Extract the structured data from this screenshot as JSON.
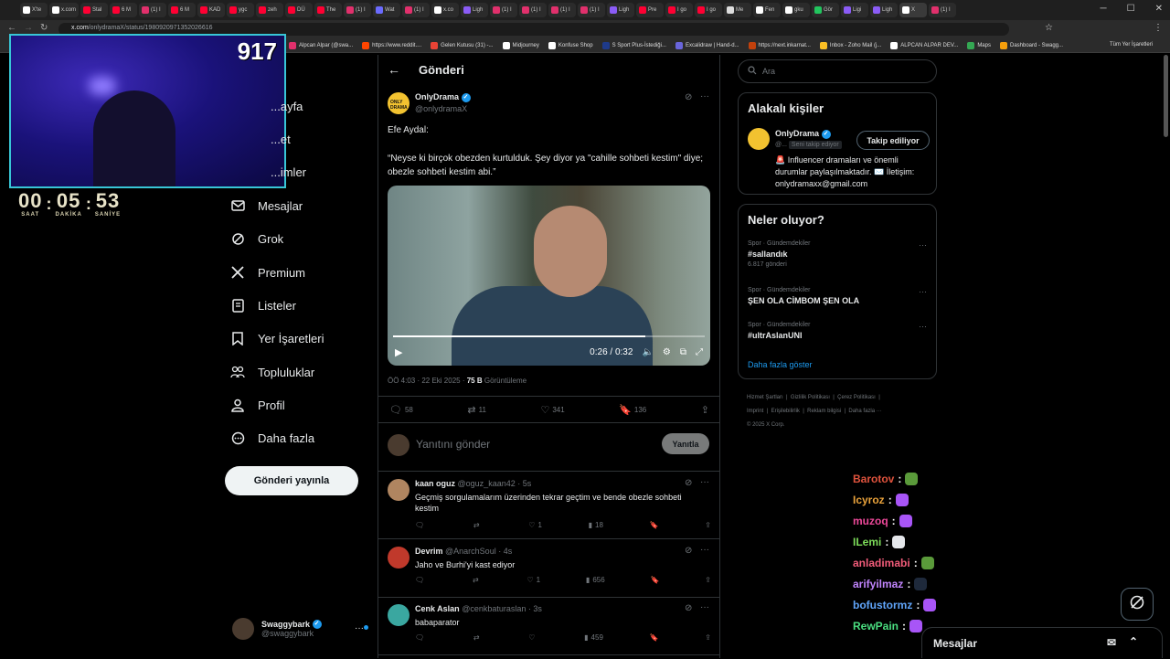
{
  "browser": {
    "tabs": [
      "X'te",
      "x.com",
      "Stal",
      "6 M",
      "(1) I",
      "6 M",
      "KAD",
      "ygc",
      "zeh",
      "DÜ",
      "The",
      "(1) I",
      "Wat",
      "(1) I",
      "x.co",
      "Ligh",
      "(1) I",
      "(1) I",
      "(1) I",
      "(1) I",
      "Ligh",
      "Pre",
      "I go",
      "I go",
      "Me",
      "Fen",
      "gku",
      "Gör",
      "Ligi",
      "Ligh",
      "X",
      "(1) I"
    ],
    "tab_colors": [
      "#fff",
      "#fff",
      "#ff0033",
      "#ff0033",
      "#e1306c",
      "#ff0033",
      "#ff0033",
      "#ff0033",
      "#ff0033",
      "#ff0033",
      "#ff0033",
      "#e1306c",
      "#6b6bff",
      "#e1306c",
      "#fff",
      "#8b5cf6",
      "#e1306c",
      "#e1306c",
      "#e1306c",
      "#e1306c",
      "#8b5cf6",
      "#ff0033",
      "#ff0033",
      "#ff0033",
      "#ddd",
      "#fff",
      "#fff",
      "#22c55e",
      "#8b5cf6",
      "#8b5cf6",
      "#fff",
      "#e1306c"
    ],
    "url_host": "x.com",
    "url_path": "/onlydramaX/status/1980920971352026616",
    "bookmarks": [
      {
        "label": "Alpcan Alpar (@swa...",
        "color": "#e1306c"
      },
      {
        "label": "https://www.reddit....",
        "color": "#ff4500"
      },
      {
        "label": "Gelen Kutusu (31) -...",
        "color": "#ea4335"
      },
      {
        "label": "Midjourney",
        "color": "#ffffff"
      },
      {
        "label": "Konfuse Shop",
        "color": "#ffffff"
      },
      {
        "label": "S Sport Plus-İstediği...",
        "color": "#1e3a8a"
      },
      {
        "label": "Excalidraw | Hand-d...",
        "color": "#6965db"
      },
      {
        "label": "https://next.inkarnat...",
        "color": "#c2410c"
      },
      {
        "label": "Inbox - Zoho Mail (j...",
        "color": "#fbbf24"
      },
      {
        "label": "ALPCAN ALPAR DEV...",
        "color": "#ffffff"
      },
      {
        "label": "Maps",
        "color": "#34a853"
      },
      {
        "label": "Dashboard - Swagg...",
        "color": "#f59e0b"
      }
    ],
    "all_bookmarks": "Tüm Yer İşaretleri"
  },
  "stream": {
    "viewer_count": "917",
    "timer": {
      "hours": "00",
      "minutes": "05",
      "seconds": "53",
      "hours_label": "SAAT",
      "minutes_label": "DAKİKA",
      "seconds_label": "SANİYE"
    },
    "chat": [
      {
        "user": "Barotov",
        "color": "#e0533d",
        "emote": "#5a9a3a"
      },
      {
        "user": "Icyroz",
        "color": "#e9a23b",
        "emote": "#a855f7"
      },
      {
        "user": "muzoq",
        "color": "#ec4899",
        "emote": "#a855f7"
      },
      {
        "user": "ILemi",
        "color": "#7ddc5a",
        "emote": "#e5e7eb"
      },
      {
        "user": "anladimabi",
        "color": "#f25c7a",
        "emote": "#5a9a3a"
      },
      {
        "user": "arifyilmaz",
        "color": "#c084fc",
        "emote": "#1e293b"
      },
      {
        "user": "bofustormz",
        "color": "#60a5fa",
        "emote": "#a855f7"
      },
      {
        "user": "RewPain",
        "color": "#4ade80",
        "emote": "#a855f7"
      }
    ]
  },
  "nav": {
    "items": [
      "...ayfa",
      "...et",
      "...imler",
      "Mesajlar",
      "Grok",
      "Premium",
      "Listeler",
      "Yer İşaretleri",
      "Topluluklar",
      "Profil",
      "Daha fazla"
    ],
    "post_button": "Gönderi yayınla",
    "account_name": "Swaggybark",
    "account_handle": "@swaggybark"
  },
  "post": {
    "header_title": "Gönderi",
    "author_name": "OnlyDrama",
    "author_handle": "@onlydramaX",
    "text_line1": "Efe Aydal:",
    "text_line2": "“Neyse ki birçok obezden kurtulduk. Şey diyor ya \"cahille sohbeti kestim\" diye; obezle sohbeti kestim abi.”",
    "video_time": "0:26 / 0:32",
    "video_progress": 0.81,
    "timestamp": "ÖÖ 4:03 · 22 Eki 2025 · ",
    "views_count": "75 B",
    "views_label": " Görüntüleme",
    "replies": "58",
    "reposts": "11",
    "likes": "341",
    "bookmarks": "136",
    "reply_placeholder": "Yanıtını gönder",
    "reply_button": "Yanıtla"
  },
  "replies": [
    {
      "name": "kaan oguz",
      "handle": "@oguz_kaan42 · 5s",
      "text": "Geçmiş sorgulamalarım üzerinden tekrar geçtim ve bende obezle sohbeti kestim",
      "replies": "",
      "reposts": "",
      "likes": "1",
      "views": "18",
      "avatar": "#b08560"
    },
    {
      "name": "Devrim",
      "handle": "@AnarchSoul · 4s",
      "text": "Jaho ve Burhi'yi kast ediyor",
      "replies": "",
      "reposts": "",
      "likes": "1",
      "views": "656",
      "avatar": "#c0392b"
    },
    {
      "name": "Cenk Aslan",
      "handle": "@cenkbaturaslan · 3s",
      "text": "babaparator",
      "replies": "",
      "reposts": "",
      "likes": "",
      "views": "459",
      "avatar": "#3aa7a0"
    }
  ],
  "sidebar": {
    "search_placeholder": "Ara",
    "related_title": "Alakalı kişiler",
    "related_name": "OnlyDrama",
    "related_handle": "@...",
    "follows_you": "Seni takip ediyor",
    "following_button": "Takip ediliyor",
    "related_bio": "🚨 Influencer dramaları ve önemli durumlar paylaşılmaktadır. ✉️ İletişim: onlydramaxx@gmail.com",
    "trends_title": "Neler oluyor?",
    "trends": [
      {
        "category": "Spor · Gündemdekiler",
        "name": "#sallandık",
        "count": "6.817 gönderi"
      },
      {
        "category": "Spor · Gündemdekiler",
        "name": "ŞEN OLA CİMBOM ŞEN OLA",
        "count": ""
      },
      {
        "category": "Spor · Gündemdekiler",
        "name": "#ultrAslanUNI",
        "count": ""
      }
    ],
    "show_more": "Daha fazla göster",
    "footer": [
      "Hizmet Şartları",
      "Gizlilik Politikası",
      "Çerez Politikası",
      "Imprint",
      "Erişilebilirlik",
      "Reklam bilgisi",
      "Daha fazla ···",
      "© 2025 X Corp."
    ]
  },
  "messages_drawer": "Mesajlar",
  "colors": {
    "accent": "#1d9bf0",
    "background": "#000000",
    "border": "#2f3336",
    "muted": "#71767b"
  }
}
